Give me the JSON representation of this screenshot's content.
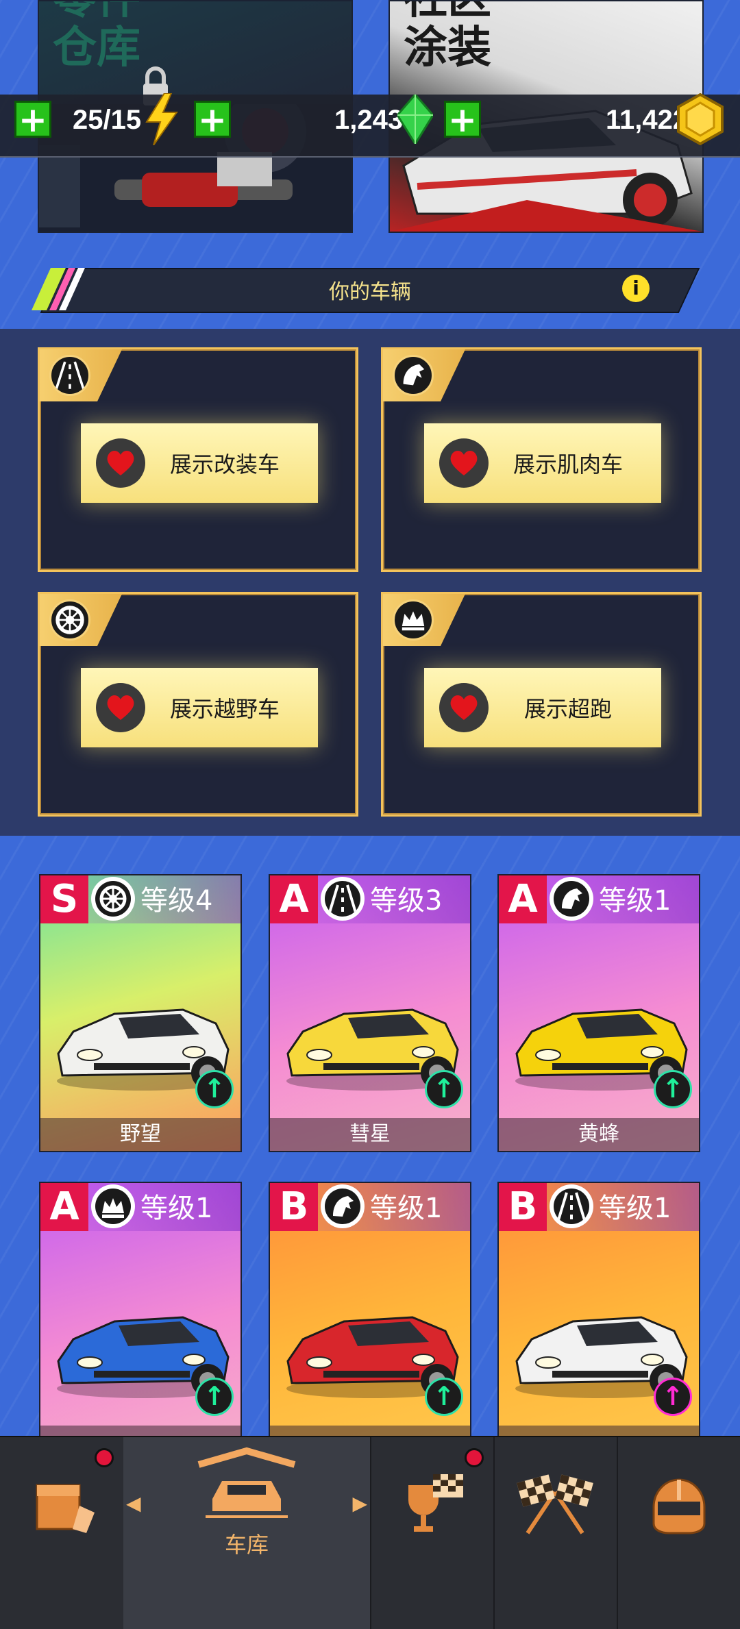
{
  "banners": {
    "parts": {
      "title_line1": "零件",
      "title_line2": "仓库"
    },
    "livery": {
      "title_line1": "社区",
      "title_line2": "涂装"
    }
  },
  "resources": {
    "fuel": "25/15",
    "gems": "1,243",
    "coins": "11,422",
    "plus": "+"
  },
  "section": {
    "title": "你的车辆",
    "info_glyph": "i"
  },
  "showcases": [
    {
      "label": "展示改装车",
      "icon": "road-icon"
    },
    {
      "label": "展示肌肉车",
      "icon": "horse-icon"
    },
    {
      "label": "展示越野车",
      "icon": "tire-icon"
    },
    {
      "label": "展示超跑",
      "icon": "crown-icon"
    }
  ],
  "cars": [
    {
      "tier": "S",
      "level": "等级4",
      "name": "野望",
      "type_icon": "tire-icon",
      "color": "#f1f1ee",
      "bg": "linear-gradient(165deg,#6ee0a0,#d8ef6a 45%,#ff9a60 100%)",
      "upgrade": "green"
    },
    {
      "tier": "A",
      "level": "等级3",
      "name": "彗星",
      "type_icon": "road-icon",
      "color": "#f7d83b",
      "bg": "linear-gradient(165deg,#c45ef0,#f58cd2 55%,#f6b1c9 100%)",
      "upgrade": "green"
    },
    {
      "tier": "A",
      "level": "等级1",
      "name": "黄蜂",
      "type_icon": "horse-icon",
      "color": "#f5d20c",
      "bg": "linear-gradient(165deg,#c45ef0,#f58cd2 55%,#f6b1c9 100%)",
      "upgrade": "green"
    },
    {
      "tier": "A",
      "level": "等级1",
      "name": "",
      "type_icon": "crown-icon",
      "color": "#2b6ad8",
      "bg": "linear-gradient(165deg,#c45ef0,#f58cd2 55%,#f6b1c9 100%)",
      "upgrade": "green"
    },
    {
      "tier": "B",
      "level": "等级1",
      "name": "",
      "type_icon": "horse-icon",
      "color": "#d8262c",
      "bg": "linear-gradient(165deg,#ff8e3a,#ffb53a 50%,#ffc94d 100%)",
      "upgrade": "green"
    },
    {
      "tier": "B",
      "level": "等级1",
      "name": "",
      "type_icon": "road-icon",
      "color": "#f2f2f2",
      "bg": "linear-gradient(165deg,#ff8e3a,#ffb53a 50%,#ffc94d 100%)",
      "upgrade": "magenta"
    }
  ],
  "nav": {
    "items": [
      {
        "id": "shop",
        "icon": "crate-icon",
        "badge": true
      },
      {
        "id": "garage",
        "icon": "garage-car-icon",
        "label": "车库",
        "active": true
      },
      {
        "id": "events",
        "icon": "trophy-icon",
        "badge": true
      },
      {
        "id": "race",
        "icon": "checkered-flags-icon"
      },
      {
        "id": "profile",
        "icon": "helmet-icon"
      }
    ],
    "arrow_left": "◀",
    "arrow_right": "▶"
  },
  "colors": {
    "background": "#3c6ad9",
    "accent_gold": "#f3c35c",
    "tier_red": "#e3154a",
    "plus_green": "#27c21b"
  }
}
